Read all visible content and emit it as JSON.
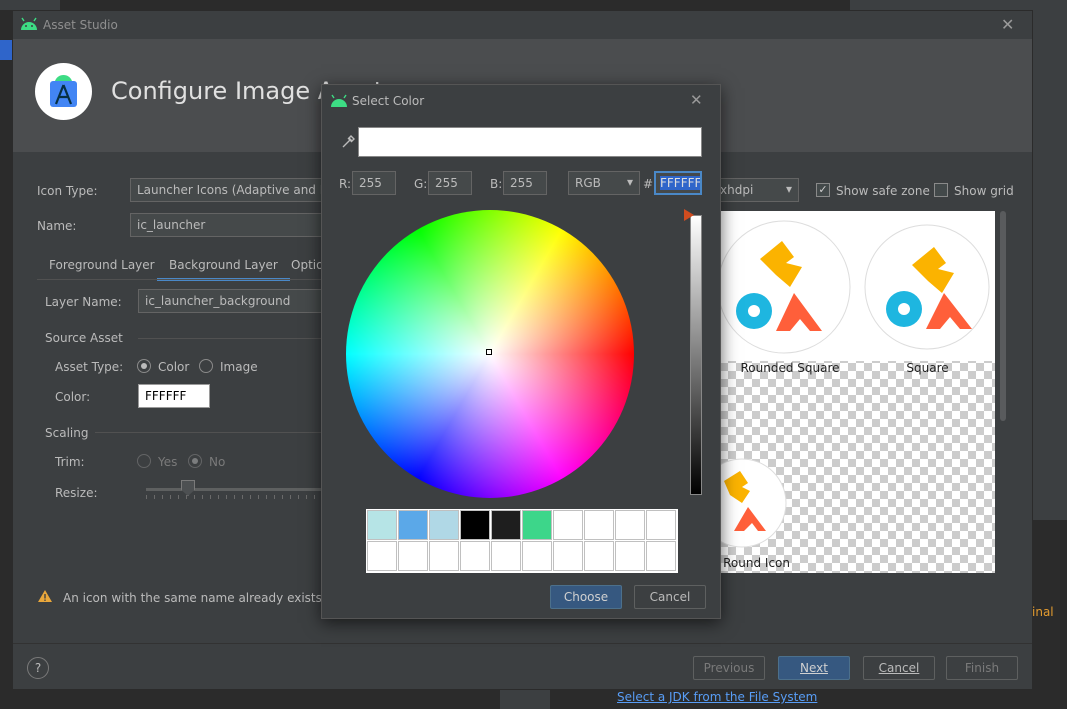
{
  "ide": {
    "terminal_text": "inal",
    "jdk_link": "Select a JDK from the File System"
  },
  "dialog": {
    "title": "Asset Studio",
    "header_title": "Configure Image Asset",
    "icon_type_label": "Icon Type:",
    "icon_type_value": "Launcher Icons (Adaptive and Legacy)",
    "name_label": "Name:",
    "name_value": "ic_launcher",
    "tabs": [
      "Foreground Layer",
      "Background Layer",
      "Options"
    ],
    "layer_name_label": "Layer Name:",
    "layer_name_value": "ic_launcher_background",
    "source_asset_label": "Source Asset",
    "asset_type_label": "Asset Type:",
    "asset_type_options": [
      "Color",
      "Image"
    ],
    "color_label": "Color:",
    "color_value": "FFFFFF",
    "scaling_label": "Scaling",
    "trim_label": "Trim:",
    "trim_options": [
      "Yes",
      "No"
    ],
    "resize_label": "Resize:",
    "warning": "An icon with the same name already exists and will be overwritten.",
    "density_value": "xhdpi",
    "show_safe_zone": "Show safe zone",
    "show_grid": "Show grid",
    "preview_labels": [
      "Rounded Square",
      "Square",
      "Round Icon"
    ],
    "buttons": {
      "previous": "Previous",
      "next": "Next",
      "cancel": "Cancel",
      "finish": "Finish"
    },
    "help": "?"
  },
  "color_picker": {
    "title": "Select Color",
    "r_label": "R:",
    "r_value": "255",
    "g_label": "G:",
    "g_value": "255",
    "b_label": "B:",
    "b_value": "255",
    "mode": "RGB",
    "hash": "#",
    "hex_value": "FFFFFF",
    "choose": "Choose",
    "cancel": "Cancel",
    "recent_colors": [
      "#b6e4e6",
      "#5ba8e8",
      "#b0d8e6",
      "#000000",
      "#1e1e1e",
      "#3dd68a",
      "#ffffff",
      "#ffffff",
      "#ffffff",
      "#ffffff",
      "#ffffff",
      "#ffffff",
      "#ffffff",
      "#ffffff",
      "#ffffff",
      "#ffffff",
      "#ffffff",
      "#ffffff",
      "#ffffff",
      "#ffffff"
    ]
  },
  "colors": {
    "accent": "#4a88c7",
    "logo_yellow": "#fbb300",
    "logo_blue": "#1eb6e0",
    "logo_orange": "#ff5f3a",
    "android_green": "#3ddc84"
  }
}
